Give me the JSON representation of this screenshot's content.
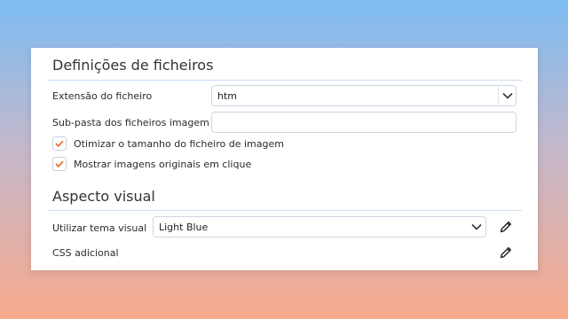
{
  "files_section": {
    "title": "Definições de ficheiros",
    "extension_label": "Extensão do ficheiro",
    "extension_value": "htm",
    "subfolder_label": "Sub-pasta dos ficheiros imagem",
    "subfolder_value": "",
    "optimize_label": "Otimizar o tamanho do ficheiro de imagem",
    "optimize_checked": true,
    "show_originals_label": "Mostrar imagens originais em clique",
    "show_originals_checked": true
  },
  "visual_section": {
    "title": "Aspecto visual",
    "theme_label": "Utilizar tema visual",
    "theme_value": "Light Blue",
    "css_label": "CSS adicional"
  },
  "icons": {
    "select": "chevron-down-icon",
    "check": "checkmark-icon",
    "edit": "pencil-icon"
  },
  "colors": {
    "accent_check": "#e8703a",
    "divider": "#c8dff5"
  }
}
